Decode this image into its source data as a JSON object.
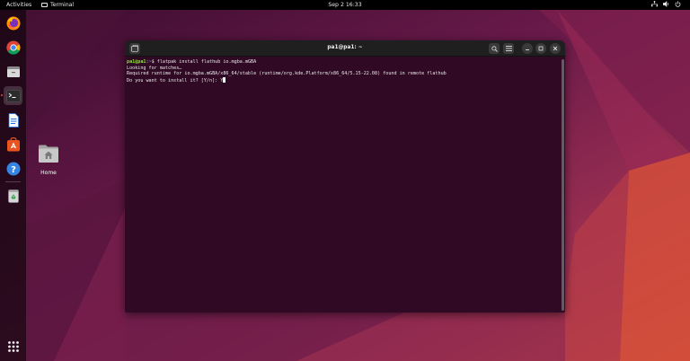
{
  "topbar": {
    "activities": "Activities",
    "app_name": "Terminal",
    "clock": "Sep 2  16:33",
    "tray_icons": [
      "network-icon",
      "volume-icon",
      "power-icon"
    ]
  },
  "dock": {
    "items": [
      {
        "name": "firefox",
        "icon": "firefox-icon"
      },
      {
        "name": "chrome",
        "icon": "chrome-icon"
      },
      {
        "name": "files",
        "icon": "files-icon"
      },
      {
        "name": "terminal",
        "icon": "terminal-icon",
        "active": true
      },
      {
        "name": "writer",
        "icon": "document-icon"
      },
      {
        "name": "software",
        "icon": "software-store-icon"
      },
      {
        "name": "help",
        "icon": "help-icon"
      },
      {
        "name": "trash",
        "icon": "trash-icon"
      }
    ],
    "show_apps_icon": "apps-grid-icon"
  },
  "desktop": {
    "home_label": "Home"
  },
  "terminal": {
    "title": "pa1@pa1: ~",
    "lines": [
      {
        "user": "pa1@pa1",
        "path": "~",
        "command": "$ flatpak install flathub io.mgba.mGBA"
      },
      {
        "text": "Looking for matches…"
      },
      {
        "text": "Required runtime for io.mgba.mGBA/x86_64/stable (runtime/org.kde.Platform/x86_64/5.15-22.08) found in remote flathub"
      },
      {
        "text": "Do you want to install it? [Y/n]: Y"
      }
    ]
  },
  "colors": {
    "terminal_bg": "#300a24",
    "prompt_user": "#8ae234",
    "prompt_path": "#729fcf",
    "accent": "#e95420"
  }
}
